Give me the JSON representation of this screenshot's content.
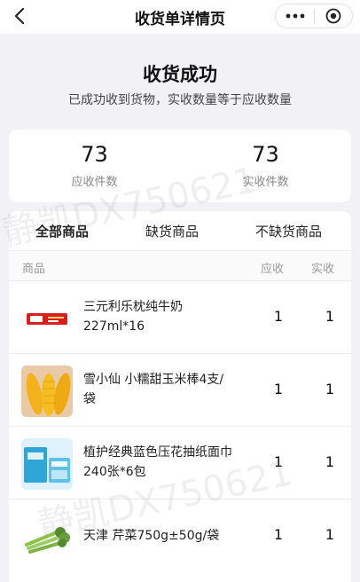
{
  "nav": {
    "title": "收货单详情页"
  },
  "hero": {
    "title": "收货成功",
    "subtitle": "已成功收到货物，实收数量等于应收数量"
  },
  "stats": {
    "expected_value": "73",
    "expected_label": "应收件数",
    "received_value": "73",
    "received_label": "实收件数"
  },
  "tabs": [
    "全部商品",
    "缺货商品",
    "不缺货商品"
  ],
  "columns": {
    "product": "商品",
    "expected": "应收",
    "received": "实收"
  },
  "items": [
    {
      "name": "三元利乐枕纯牛奶227ml*16",
      "expected": "1",
      "received": "1"
    },
    {
      "name": "雪小仙 小糯甜玉米棒4支/袋",
      "expected": "1",
      "received": "1"
    },
    {
      "name": "植护经典蓝色压花抽纸面巾 240张*6包",
      "expected": "1",
      "received": "1"
    },
    {
      "name": "天津 芹菜750g±50g/袋",
      "expected": "1",
      "received": "1"
    }
  ],
  "watermark": {
    "text": "静凯DX750621"
  },
  "colors": {
    "accent": "#d81e1e",
    "background": "#f2f2f6",
    "muted": "#888888"
  }
}
